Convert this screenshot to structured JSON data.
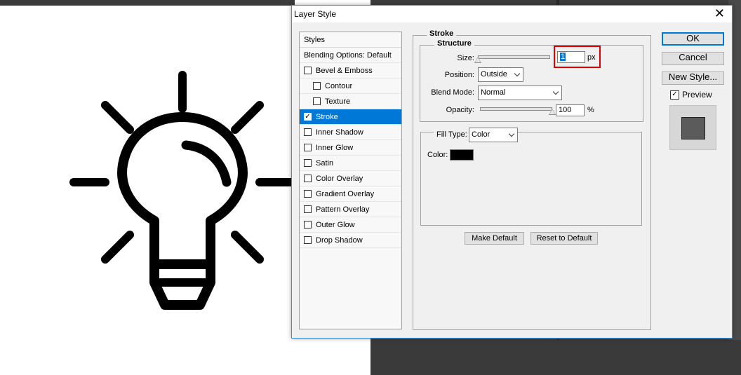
{
  "dialog": {
    "title": "Layer Style"
  },
  "styles_list": {
    "header": "Styles",
    "blending": "Blending Options: Default",
    "items": [
      {
        "label": "Bevel & Emboss",
        "checked": false,
        "indent": false,
        "selected": false
      },
      {
        "label": "Contour",
        "checked": false,
        "indent": true,
        "selected": false
      },
      {
        "label": "Texture",
        "checked": false,
        "indent": true,
        "selected": false
      },
      {
        "label": "Stroke",
        "checked": true,
        "indent": false,
        "selected": true
      },
      {
        "label": "Inner Shadow",
        "checked": false,
        "indent": false,
        "selected": false
      },
      {
        "label": "Inner Glow",
        "checked": false,
        "indent": false,
        "selected": false
      },
      {
        "label": "Satin",
        "checked": false,
        "indent": false,
        "selected": false
      },
      {
        "label": "Color Overlay",
        "checked": false,
        "indent": false,
        "selected": false
      },
      {
        "label": "Gradient Overlay",
        "checked": false,
        "indent": false,
        "selected": false
      },
      {
        "label": "Pattern Overlay",
        "checked": false,
        "indent": false,
        "selected": false
      },
      {
        "label": "Outer Glow",
        "checked": false,
        "indent": false,
        "selected": false
      },
      {
        "label": "Drop Shadow",
        "checked": false,
        "indent": false,
        "selected": false
      }
    ]
  },
  "stroke": {
    "heading": "Stroke",
    "structure_heading": "Structure",
    "size_label": "Size:",
    "size_value": "1",
    "size_unit": "px",
    "size_slider_fraction": 0.0,
    "position_label": "Position:",
    "position_value": "Outside",
    "blend_mode_label": "Blend Mode:",
    "blend_mode_value": "Normal",
    "opacity_label": "Opacity:",
    "opacity_value": "100",
    "opacity_unit": "%",
    "opacity_slider_fraction": 1.0,
    "fill_type_label": "Fill Type:",
    "fill_type_value": "Color",
    "color_label": "Color:",
    "color_value": "#000000",
    "make_default": "Make Default",
    "reset_default": "Reset to Default"
  },
  "buttons": {
    "ok": "OK",
    "cancel": "Cancel",
    "new_style": "New Style...",
    "preview_label": "Preview",
    "preview_checked": true
  },
  "colors": {
    "accent": "#0078d7",
    "highlight": "#e00000",
    "preview_swatch": "#5b5b5b"
  }
}
